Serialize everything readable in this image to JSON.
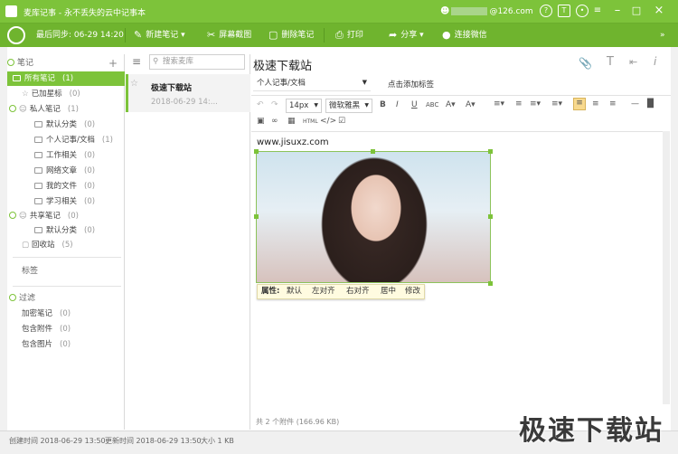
{
  "window": {
    "title": "麦库记事 - 永不丢失的云中记事本",
    "user_suffix": "@126.com"
  },
  "toolbar": {
    "sync_label": "最后同步: 06-29 14:20",
    "new_note": "新建笔记",
    "screenshot": "屏幕截图",
    "delete": "删除笔记",
    "print": "打印",
    "share": "分享",
    "wechat": "连接微信"
  },
  "sidebar": {
    "notes_header": "笔记",
    "items": [
      {
        "label": "所有笔记",
        "count": "(1)"
      },
      {
        "label": "已加星标",
        "count": "(0)"
      },
      {
        "label": "私人笔记",
        "count": "(1)"
      },
      {
        "label": "默认分类",
        "count": "(0)"
      },
      {
        "label": "个人记事/文档",
        "count": "(1)"
      },
      {
        "label": "工作相关",
        "count": "(0)"
      },
      {
        "label": "网络文章",
        "count": "(0)"
      },
      {
        "label": "我的文件",
        "count": "(0)"
      },
      {
        "label": "学习相关",
        "count": "(0)"
      },
      {
        "label": "共享笔记",
        "count": "(0)"
      },
      {
        "label": "默认分类",
        "count": "(0)"
      },
      {
        "label": "回收站",
        "count": "(5)"
      }
    ],
    "tags_header": "标签",
    "filter_header": "过滤",
    "filters": [
      {
        "label": "加密笔记",
        "count": "(0)"
      },
      {
        "label": "包含附件",
        "count": "(0)"
      },
      {
        "label": "包含图片",
        "count": "(0)"
      }
    ]
  },
  "notelist": {
    "search_placeholder": "搜索麦库",
    "note_title": "极速下载站",
    "note_date": "2018-06-29 14:..."
  },
  "editor": {
    "title": "极速下载站",
    "category": "个人记事/文档",
    "add_tag": "点击添加标签",
    "font_size": "14px",
    "font_family": "微软雅黑",
    "url_text": "www.jisuxz.com",
    "image_bar": {
      "label": "属性:",
      "options": [
        "默认",
        "左对齐",
        "右对齐",
        "居中",
        "修改"
      ]
    },
    "attachments": "共 2 个附件 (166.96 KB)"
  },
  "status": {
    "created": "创建时间 2018-06-29 13:50",
    "updated": "更新时间 2018-06-29 13:50",
    "size": "大小 1 KB"
  },
  "watermark": "极速下载站",
  "colors": {
    "accent": "#7dc33a",
    "toolbar": "#6fb42e"
  }
}
